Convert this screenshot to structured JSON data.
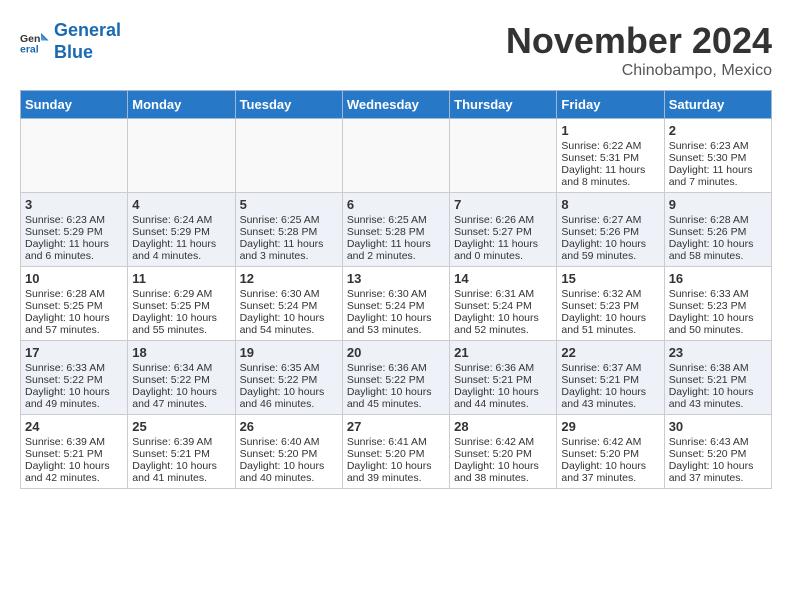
{
  "header": {
    "logo_line1": "General",
    "logo_line2": "Blue",
    "month": "November 2024",
    "location": "Chinobampo, Mexico"
  },
  "weekdays": [
    "Sunday",
    "Monday",
    "Tuesday",
    "Wednesday",
    "Thursday",
    "Friday",
    "Saturday"
  ],
  "weeks": [
    [
      {
        "day": "",
        "info": ""
      },
      {
        "day": "",
        "info": ""
      },
      {
        "day": "",
        "info": ""
      },
      {
        "day": "",
        "info": ""
      },
      {
        "day": "",
        "info": ""
      },
      {
        "day": "1",
        "info": "Sunrise: 6:22 AM\nSunset: 5:31 PM\nDaylight: 11 hours and 8 minutes."
      },
      {
        "day": "2",
        "info": "Sunrise: 6:23 AM\nSunset: 5:30 PM\nDaylight: 11 hours and 7 minutes."
      }
    ],
    [
      {
        "day": "3",
        "info": "Sunrise: 6:23 AM\nSunset: 5:29 PM\nDaylight: 11 hours and 6 minutes."
      },
      {
        "day": "4",
        "info": "Sunrise: 6:24 AM\nSunset: 5:29 PM\nDaylight: 11 hours and 4 minutes."
      },
      {
        "day": "5",
        "info": "Sunrise: 6:25 AM\nSunset: 5:28 PM\nDaylight: 11 hours and 3 minutes."
      },
      {
        "day": "6",
        "info": "Sunrise: 6:25 AM\nSunset: 5:28 PM\nDaylight: 11 hours and 2 minutes."
      },
      {
        "day": "7",
        "info": "Sunrise: 6:26 AM\nSunset: 5:27 PM\nDaylight: 11 hours and 0 minutes."
      },
      {
        "day": "8",
        "info": "Sunrise: 6:27 AM\nSunset: 5:26 PM\nDaylight: 10 hours and 59 minutes."
      },
      {
        "day": "9",
        "info": "Sunrise: 6:28 AM\nSunset: 5:26 PM\nDaylight: 10 hours and 58 minutes."
      }
    ],
    [
      {
        "day": "10",
        "info": "Sunrise: 6:28 AM\nSunset: 5:25 PM\nDaylight: 10 hours and 57 minutes."
      },
      {
        "day": "11",
        "info": "Sunrise: 6:29 AM\nSunset: 5:25 PM\nDaylight: 10 hours and 55 minutes."
      },
      {
        "day": "12",
        "info": "Sunrise: 6:30 AM\nSunset: 5:24 PM\nDaylight: 10 hours and 54 minutes."
      },
      {
        "day": "13",
        "info": "Sunrise: 6:30 AM\nSunset: 5:24 PM\nDaylight: 10 hours and 53 minutes."
      },
      {
        "day": "14",
        "info": "Sunrise: 6:31 AM\nSunset: 5:24 PM\nDaylight: 10 hours and 52 minutes."
      },
      {
        "day": "15",
        "info": "Sunrise: 6:32 AM\nSunset: 5:23 PM\nDaylight: 10 hours and 51 minutes."
      },
      {
        "day": "16",
        "info": "Sunrise: 6:33 AM\nSunset: 5:23 PM\nDaylight: 10 hours and 50 minutes."
      }
    ],
    [
      {
        "day": "17",
        "info": "Sunrise: 6:33 AM\nSunset: 5:22 PM\nDaylight: 10 hours and 49 minutes."
      },
      {
        "day": "18",
        "info": "Sunrise: 6:34 AM\nSunset: 5:22 PM\nDaylight: 10 hours and 47 minutes."
      },
      {
        "day": "19",
        "info": "Sunrise: 6:35 AM\nSunset: 5:22 PM\nDaylight: 10 hours and 46 minutes."
      },
      {
        "day": "20",
        "info": "Sunrise: 6:36 AM\nSunset: 5:22 PM\nDaylight: 10 hours and 45 minutes."
      },
      {
        "day": "21",
        "info": "Sunrise: 6:36 AM\nSunset: 5:21 PM\nDaylight: 10 hours and 44 minutes."
      },
      {
        "day": "22",
        "info": "Sunrise: 6:37 AM\nSunset: 5:21 PM\nDaylight: 10 hours and 43 minutes."
      },
      {
        "day": "23",
        "info": "Sunrise: 6:38 AM\nSunset: 5:21 PM\nDaylight: 10 hours and 43 minutes."
      }
    ],
    [
      {
        "day": "24",
        "info": "Sunrise: 6:39 AM\nSunset: 5:21 PM\nDaylight: 10 hours and 42 minutes."
      },
      {
        "day": "25",
        "info": "Sunrise: 6:39 AM\nSunset: 5:21 PM\nDaylight: 10 hours and 41 minutes."
      },
      {
        "day": "26",
        "info": "Sunrise: 6:40 AM\nSunset: 5:20 PM\nDaylight: 10 hours and 40 minutes."
      },
      {
        "day": "27",
        "info": "Sunrise: 6:41 AM\nSunset: 5:20 PM\nDaylight: 10 hours and 39 minutes."
      },
      {
        "day": "28",
        "info": "Sunrise: 6:42 AM\nSunset: 5:20 PM\nDaylight: 10 hours and 38 minutes."
      },
      {
        "day": "29",
        "info": "Sunrise: 6:42 AM\nSunset: 5:20 PM\nDaylight: 10 hours and 37 minutes."
      },
      {
        "day": "30",
        "info": "Sunrise: 6:43 AM\nSunset: 5:20 PM\nDaylight: 10 hours and 37 minutes."
      }
    ]
  ]
}
